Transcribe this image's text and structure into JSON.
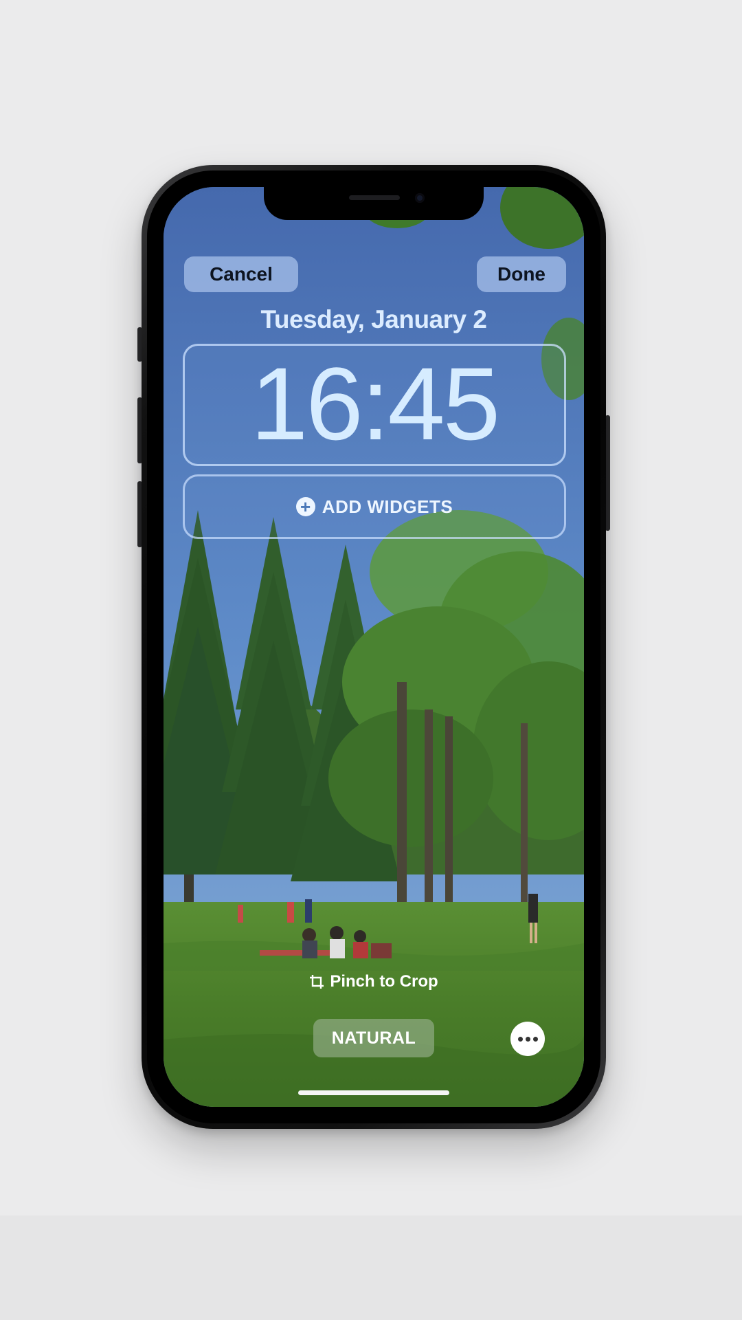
{
  "top_bar": {
    "cancel_label": "Cancel",
    "done_label": "Done"
  },
  "lock_screen": {
    "date": "Tuesday, January 2",
    "time": "16:45",
    "add_widgets_label": "ADD WIDGETS"
  },
  "bottom": {
    "crop_hint": "Pinch to Crop",
    "filter_label": "NATURAL"
  },
  "icons": {
    "add": "plus-circle-icon",
    "crop": "crop-icon",
    "more": "ellipsis-icon"
  },
  "colors": {
    "sky": "#4870b3",
    "grass": "#4f8430",
    "clock_text": "#d6ecff"
  }
}
